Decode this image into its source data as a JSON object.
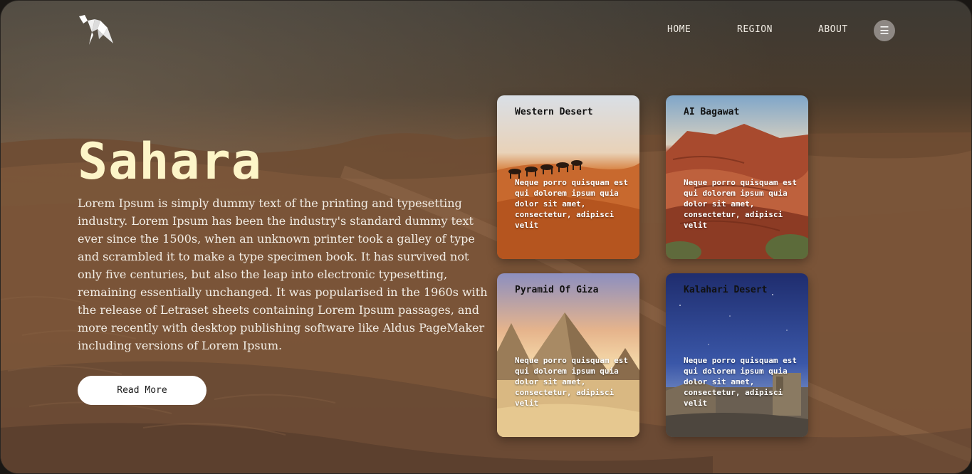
{
  "nav": {
    "items": [
      {
        "label": "HOME"
      },
      {
        "label": "REGION"
      },
      {
        "label": "ABOUT"
      }
    ],
    "menu_icon": "hamburger-icon"
  },
  "hero": {
    "title": "Sahara",
    "description": "Lorem Ipsum is simply dummy text of the printing and typesetting industry. Lorem Ipsum has been the industry's standard dummy text ever since the 1500s, when an unknown printer took a galley of type and scrambled it to make a type specimen book. It has survived not only five centuries, but also the leap into electronic typesetting, remaining essentially unchanged. It was popularised in the 1960s with the release of Letraset sheets containing Lorem Ipsum passages, and more recently with desktop publishing software like Aldus PageMaker including versions of Lorem Ipsum.",
    "button_label": "Read More"
  },
  "cards": [
    {
      "title": "Western Desert",
      "text": "Neque porro quisquam est qui dolorem ipsum quia dolor sit amet, consectetur, adipisci velit"
    },
    {
      "title": "AI Bagawat",
      "text": "Neque porro quisquam est qui dolorem ipsum quia dolor sit amet, consectetur, adipisci velit"
    },
    {
      "title": "Pyramid Of Giza",
      "text": "Neque porro quisquam est qui dolorem ipsum quia dolor sit amet, consectetur, adipisci velit"
    },
    {
      "title": "Kalahari Desert",
      "text": "Neque porro quisquam est qui dolorem ipsum quia dolor sit amet, consectetur, adipisci velit"
    }
  ],
  "colors": {
    "title": "#fdf5c8",
    "button_bg": "#ffffff",
    "menu_button_bg": "#8e8884"
  },
  "logo_icon": "origami-horse-logo"
}
